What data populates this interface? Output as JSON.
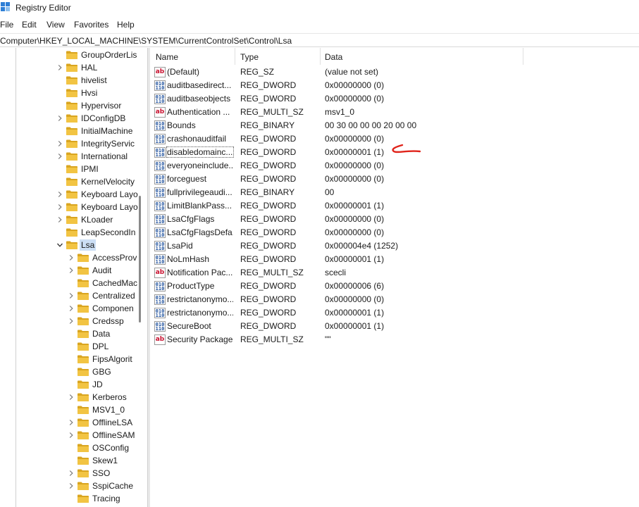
{
  "window": {
    "title": "Registry Editor"
  },
  "menu": [
    "File",
    "Edit",
    "View",
    "Favorites",
    "Help"
  ],
  "address": "Computer\\HKEY_LOCAL_MACHINE\\SYSTEM\\CurrentControlSet\\Control\\Lsa",
  "tree": {
    "parent_items": [
      {
        "label": "GroupOrderLis",
        "expander": false
      },
      {
        "label": "HAL",
        "expander": true
      },
      {
        "label": "hivelist",
        "expander": false
      },
      {
        "label": "Hvsi",
        "expander": false
      },
      {
        "label": "Hypervisor",
        "expander": false
      },
      {
        "label": "IDConfigDB",
        "expander": true
      },
      {
        "label": "InitialMachine",
        "expander": false
      },
      {
        "label": "IntegrityServic",
        "expander": true
      },
      {
        "label": "International",
        "expander": true
      },
      {
        "label": "IPMI",
        "expander": false
      },
      {
        "label": "KernelVelocity",
        "expander": false
      },
      {
        "label": "Keyboard Layo",
        "expander": true
      },
      {
        "label": "Keyboard Layo",
        "expander": true
      },
      {
        "label": "KLoader",
        "expander": true
      },
      {
        "label": "LeapSecondIn",
        "expander": false
      }
    ],
    "selected": {
      "label": "Lsa",
      "expander": "expanded"
    },
    "child_items": [
      {
        "label": "AccessProv",
        "expander": true
      },
      {
        "label": "Audit",
        "expander": true
      },
      {
        "label": "CachedMac",
        "expander": false
      },
      {
        "label": "Centralized",
        "expander": true
      },
      {
        "label": "Componen",
        "expander": true
      },
      {
        "label": "Credssp",
        "expander": true
      },
      {
        "label": "Data",
        "expander": false
      },
      {
        "label": "DPL",
        "expander": false
      },
      {
        "label": "FipsAlgorit",
        "expander": false
      },
      {
        "label": "GBG",
        "expander": false
      },
      {
        "label": "JD",
        "expander": false
      },
      {
        "label": "Kerberos",
        "expander": true
      },
      {
        "label": "MSV1_0",
        "expander": false
      },
      {
        "label": "OfflineLSA",
        "expander": true
      },
      {
        "label": "OfflineSAM",
        "expander": true
      },
      {
        "label": "OSConfig",
        "expander": false
      },
      {
        "label": "Skew1",
        "expander": false
      },
      {
        "label": "SSO",
        "expander": true
      },
      {
        "label": "SspiCache",
        "expander": true
      },
      {
        "label": "Tracing",
        "expander": false
      }
    ]
  },
  "columns": {
    "name": "Name",
    "type": "Type",
    "data": "Data"
  },
  "values": [
    {
      "icon": "string",
      "name": "(Default)",
      "type": "REG_SZ",
      "data": "(value not set)"
    },
    {
      "icon": "binary",
      "name": "auditbasedirect...",
      "type": "REG_DWORD",
      "data": "0x00000000 (0)"
    },
    {
      "icon": "binary",
      "name": "auditbaseobjects",
      "type": "REG_DWORD",
      "data": "0x00000000 (0)"
    },
    {
      "icon": "string",
      "name": "Authentication ...",
      "type": "REG_MULTI_SZ",
      "data": "msv1_0"
    },
    {
      "icon": "binary",
      "name": "Bounds",
      "type": "REG_BINARY",
      "data": "00 30 00 00 00 20 00 00"
    },
    {
      "icon": "binary",
      "name": "crashonauditfail",
      "type": "REG_DWORD",
      "data": "0x00000000 (0)"
    },
    {
      "icon": "binary",
      "name": "disabledomainc...",
      "type": "REG_DWORD",
      "data": "0x00000001 (1)",
      "focused": true
    },
    {
      "icon": "binary",
      "name": "everyoneinclude...",
      "type": "REG_DWORD",
      "data": "0x00000000 (0)"
    },
    {
      "icon": "binary",
      "name": "forceguest",
      "type": "REG_DWORD",
      "data": "0x00000000 (0)"
    },
    {
      "icon": "binary",
      "name": "fullprivilegeaudi...",
      "type": "REG_BINARY",
      "data": "00"
    },
    {
      "icon": "binary",
      "name": "LimitBlankPass...",
      "type": "REG_DWORD",
      "data": "0x00000001 (1)"
    },
    {
      "icon": "binary",
      "name": "LsaCfgFlags",
      "type": "REG_DWORD",
      "data": "0x00000000 (0)"
    },
    {
      "icon": "binary",
      "name": "LsaCfgFlagsDefa...",
      "type": "REG_DWORD",
      "data": "0x00000000 (0)"
    },
    {
      "icon": "binary",
      "name": "LsaPid",
      "type": "REG_DWORD",
      "data": "0x000004e4 (1252)"
    },
    {
      "icon": "binary",
      "name": "NoLmHash",
      "type": "REG_DWORD",
      "data": "0x00000001 (1)"
    },
    {
      "icon": "string",
      "name": "Notification Pac...",
      "type": "REG_MULTI_SZ",
      "data": "scecli"
    },
    {
      "icon": "binary",
      "name": "ProductType",
      "type": "REG_DWORD",
      "data": "0x00000006 (6)"
    },
    {
      "icon": "binary",
      "name": "restrictanonymo...",
      "type": "REG_DWORD",
      "data": "0x00000000 (0)"
    },
    {
      "icon": "binary",
      "name": "restrictanonymo...",
      "type": "REG_DWORD",
      "data": "0x00000001 (1)"
    },
    {
      "icon": "binary",
      "name": "SecureBoot",
      "type": "REG_DWORD",
      "data": "0x00000001 (1)"
    },
    {
      "icon": "string",
      "name": "Security Packages",
      "type": "REG_MULTI_SZ",
      "data": "\"\""
    }
  ],
  "colors": {
    "folder": "#f2c443",
    "folder_dark": "#d9a520",
    "selection": "#ccdff5",
    "annotation": "#e0241b"
  }
}
